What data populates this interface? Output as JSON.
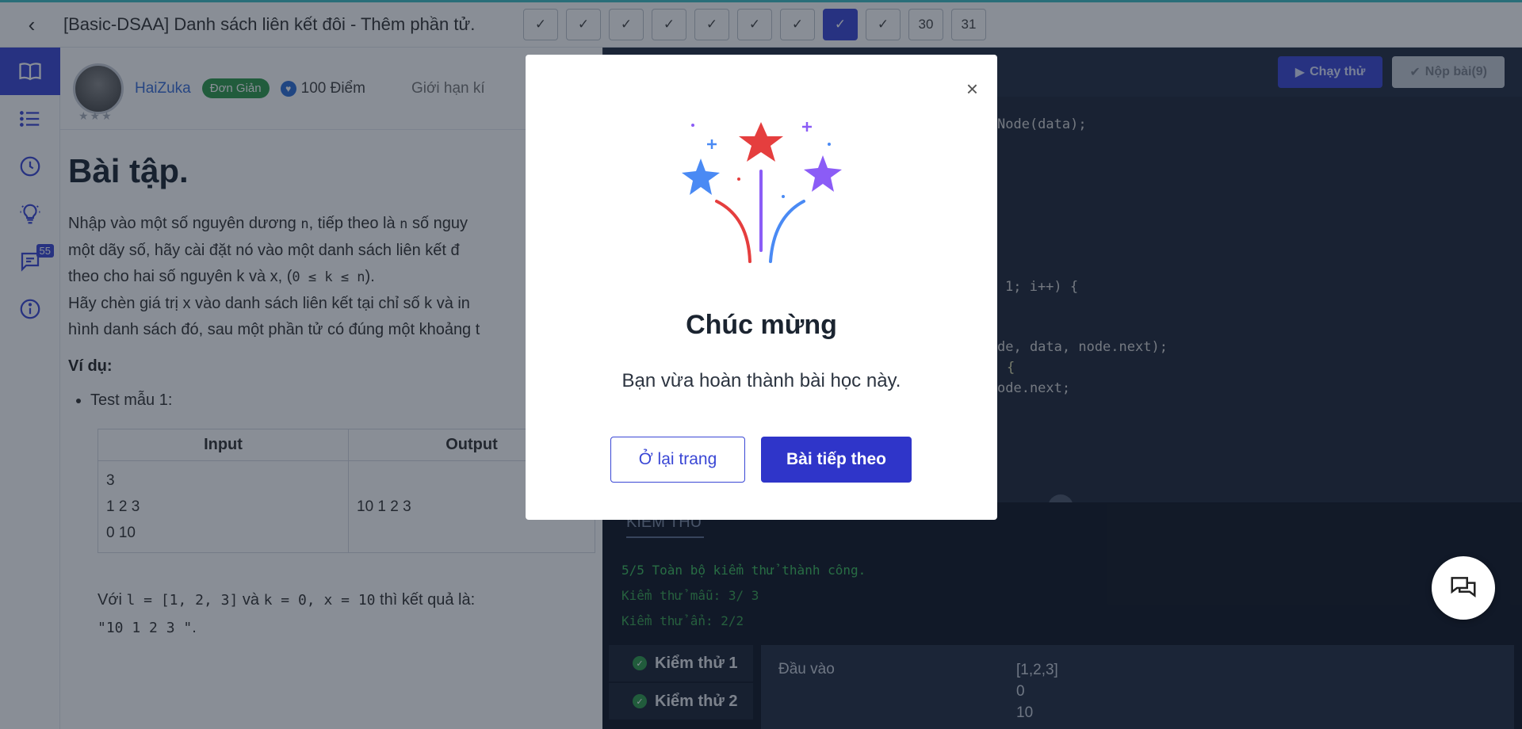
{
  "topbar": {
    "title": "[Basic-DSAA] Danh sách liên kết đôi - Thêm phần tử.",
    "steps": [
      "✓",
      "✓",
      "✓",
      "✓",
      "✓",
      "✓",
      "✓",
      "✓",
      "✓",
      "30",
      "31"
    ],
    "active_step_index": 7
  },
  "rail": {
    "items": [
      "book-icon",
      "list-icon",
      "clock-icon",
      "lightbulb-icon",
      "chat-icon",
      "info-icon"
    ],
    "chat_badge": "55"
  },
  "problem": {
    "author": "HaiZuka",
    "level": "Đơn Giản",
    "points": "100 Điểm",
    "limit": "Giới hạn kí",
    "heading": "Bài tập.",
    "p1_a": "Nhập vào một số nguyên dương ",
    "p1_n": "n",
    "p1_b": ", tiếp theo là ",
    "p1_n2": "n",
    "p1_c": " số nguy",
    "p2": "một dãy số, hãy cài đặt nó vào một danh sách liên kết đ",
    "p3_a": "theo cho hai số nguyên k và x, (",
    "p3_code": "0 ≤ k ≤ n",
    "p3_b": ").",
    "p4": "Hãy chèn giá trị x vào danh sách liên kết tại chỉ số k và in",
    "p5": "hình danh sách đó, sau một phần tử có đúng một khoảng t",
    "example_label": "Ví dụ:",
    "bullet": "Test mẫu 1:",
    "table": {
      "headers": [
        "Input",
        "Output"
      ],
      "input_lines": [
        "3",
        "1 2 3",
        "0 10"
      ],
      "output": "10 1 2 3"
    },
    "expl_a": "Với ",
    "expl_code1": "l = [1, 2, 3]",
    "expl_b": " và ",
    "expl_code2": "k = 0, x = 10",
    "expl_c": " thì kết quả là:",
    "expl_code3": "\"10 1 2 3 \"",
    "expl_d": "."
  },
  "editor": {
    "run_label": "Chạy thử",
    "submit_label": "Nộp bài(9)",
    "lines": {
      "l1": "Node(data);",
      "l2": "1; i++) {",
      "l3": "de, data, node.next);",
      "l4": "{",
      "l5": "ode.next;"
    }
  },
  "tests": {
    "tab": "KIỂM THỬ",
    "summary": "5/5 Toàn bộ kiểm thử thành công.",
    "sample": "Kiểm thử mẫu: 3/ 3",
    "hidden": "Kiểm thử ẩn: 2/2",
    "items": [
      "Kiểm thử 1",
      "Kiểm thử 2"
    ],
    "detail_label": "Đầu vào",
    "detail_values": [
      "[1,2,3]",
      "0",
      "10"
    ]
  },
  "modal": {
    "title": "Chúc mừng",
    "text": "Bạn vừa hoàn thành bài học này.",
    "stay_label": "Ở lại trang",
    "next_label": "Bài tiếp theo",
    "close_glyph": "×"
  },
  "colors": {
    "primary": "#3a47d5",
    "success": "#2f9a4a",
    "star_red": "#e53e3e",
    "star_blue": "#4a8af4",
    "star_purple": "#8b5cf6"
  }
}
